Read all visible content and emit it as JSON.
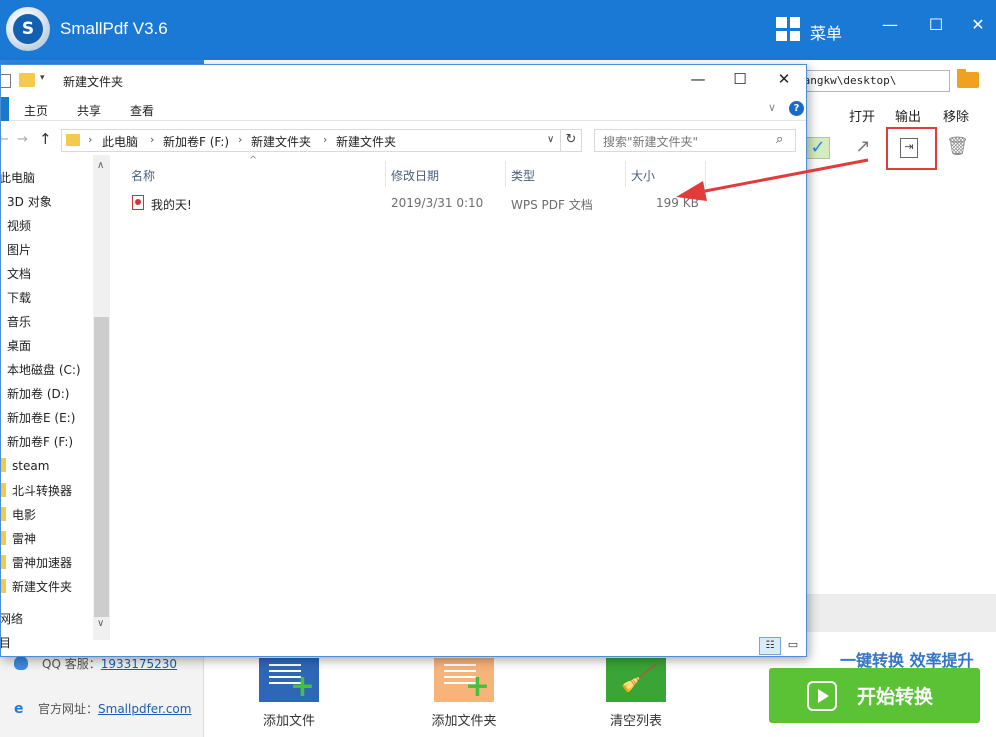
{
  "app": {
    "title": "SmallPdf V3.6",
    "logo_letter": "S",
    "menu_label": "菜单",
    "minimize": "—",
    "maximize": "☐",
    "close": "✕",
    "output_path": "tangkw\\desktop\\",
    "columns": {
      "open": "打开",
      "output": "输出",
      "remove": "移除"
    },
    "icons": {
      "check": "✓",
      "open": "↗",
      "output": "⇥",
      "remove": "🗑"
    },
    "contact": {
      "qq_label": "QQ 客服：",
      "qq_number": "1933175230",
      "site_label": "官方网址：",
      "site_url": "Smallpdfer.com"
    },
    "tools": {
      "add_file": "添加文件",
      "add_folder": "添加文件夹",
      "clear_list": "清空列表"
    },
    "slogan": "一键转换  效率提升",
    "start_button": "开始转换",
    "colors": {
      "title_bar": "#1b79d6",
      "start_button": "#5bc236",
      "highlight": "#e23b3b"
    }
  },
  "explorer": {
    "title": "新建文件夹",
    "controls": {
      "minimize": "—",
      "maximize": "☐",
      "close": "✕"
    },
    "ribbon_tabs": [
      "主页",
      "共享",
      "查看"
    ],
    "help": "?",
    "nav": {
      "back": "←",
      "forward": "→",
      "up": "↑",
      "refresh": "↻",
      "dropdown": "∨",
      "search_glyph": "⌕"
    },
    "breadcrumbs": [
      "此电脑",
      "新加卷F (F:)",
      "新建文件夹",
      "新建文件夹"
    ],
    "search_placeholder": "搜索\"新建文件夹\"",
    "tree": [
      "此电脑",
      "3D 对象",
      "视频",
      "图片",
      "文档",
      "下载",
      "音乐",
      "桌面",
      "本地磁盘 (C:)",
      "新加卷 (D:)",
      "新加卷E (E:)",
      "新加卷F (F:)",
      "steam",
      "北斗转换器",
      "电影",
      "雷神",
      "雷神加速器",
      "新建文件夹",
      "网络",
      "目"
    ],
    "columns": {
      "name": "名称",
      "date": "修改日期",
      "type": "类型",
      "size": "大小"
    },
    "files": [
      {
        "name": "我的天!",
        "date": "2019/3/31 0:10",
        "type": "WPS PDF 文档",
        "size": "199 KB"
      }
    ]
  }
}
